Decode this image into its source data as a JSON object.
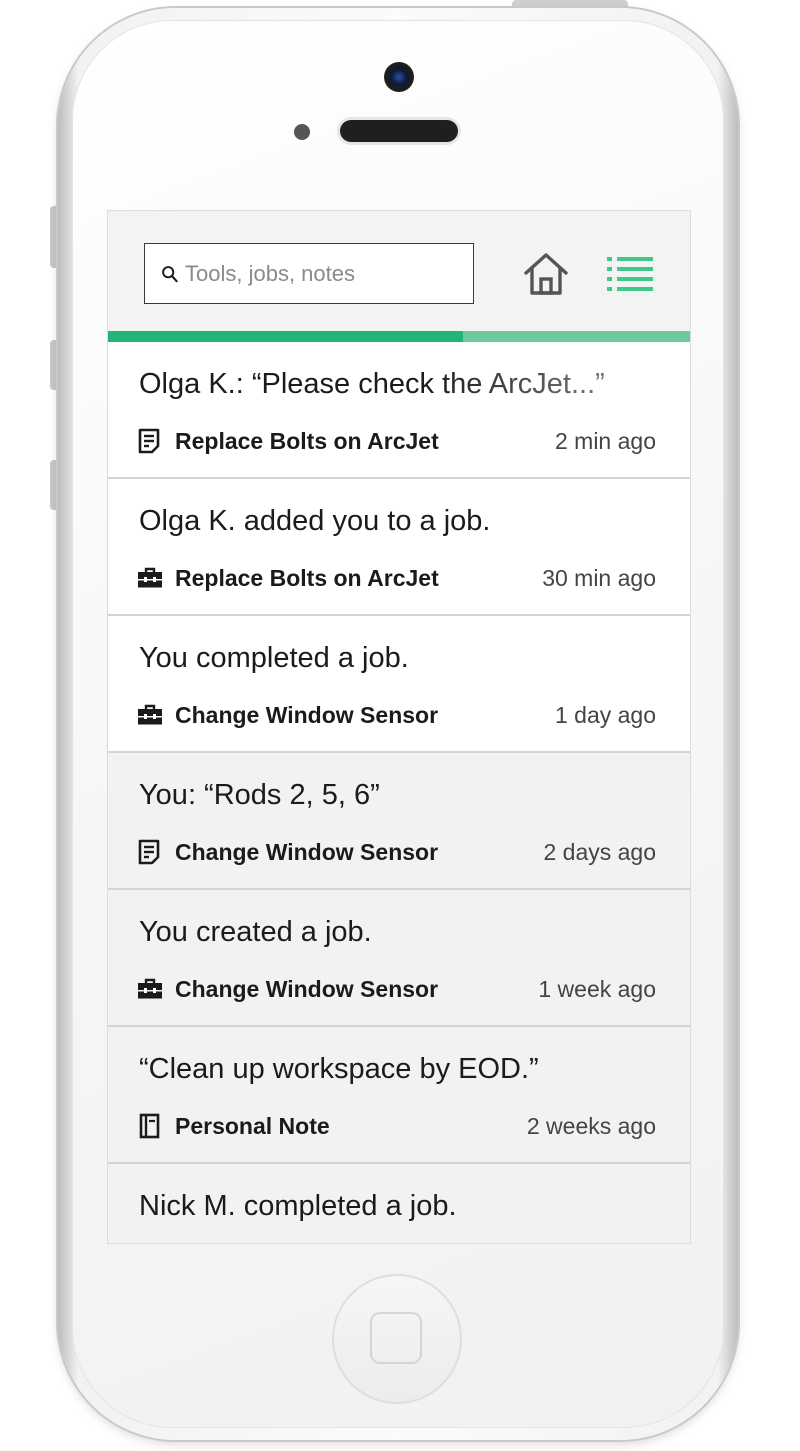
{
  "search": {
    "placeholder": "Tools, jobs, notes"
  },
  "nav": {
    "home_icon": "home-icon",
    "list_icon": "list-icon"
  },
  "progress": {
    "fraction": 0.61,
    "colors": {
      "fill": "#23b577",
      "track": "#6ccb9d"
    }
  },
  "feed": [
    {
      "message": "Olga K.: “Please check the ArcJet...”",
      "job": "Replace Bolts on ArcJet",
      "time": "2 min ago",
      "icon": "note-icon",
      "unread": true
    },
    {
      "message": "Olga K. added you to a job.",
      "job": "Replace Bolts on ArcJet",
      "time": "30 min ago",
      "icon": "toolbox-icon",
      "unread": true
    },
    {
      "message": "You completed a job.",
      "job": "Change Window Sensor",
      "time": "1 day ago",
      "icon": "toolbox-icon",
      "unread": true
    },
    {
      "message": "You: “Rods 2, 5, 6”",
      "job": "Change Window Sensor",
      "time": "2 days ago",
      "icon": "note-icon",
      "unread": false
    },
    {
      "message": "You created a job.",
      "job": "Change Window Sensor",
      "time": "1 week ago",
      "icon": "toolbox-icon",
      "unread": false
    },
    {
      "message": "“Clean up workspace by EOD.”",
      "job": "Personal Note",
      "time": "2 weeks ago",
      "icon": "notebook-icon",
      "unread": false
    },
    {
      "message": "Nick M. completed a job.",
      "job": "",
      "time": "",
      "icon": "toolbox-icon",
      "unread": false
    }
  ]
}
